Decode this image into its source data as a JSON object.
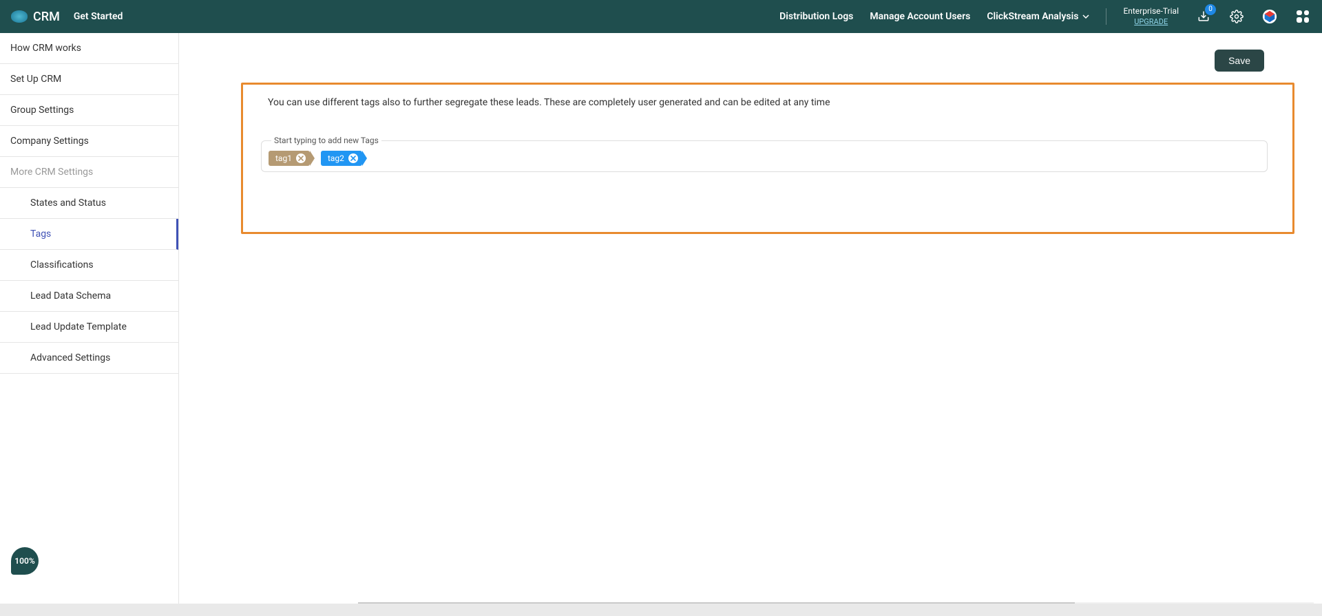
{
  "header": {
    "app_name": "CRM",
    "get_started": "Get Started",
    "nav": {
      "distribution_logs": "Distribution Logs",
      "manage_users": "Manage Account Users",
      "clickstream": "ClickStream Analysis"
    },
    "trial": {
      "line1": "Enterprise-Trial",
      "upgrade": "UPGRADE"
    },
    "notification_count": "0"
  },
  "sidebar": {
    "items": [
      {
        "label": "How CRM works"
      },
      {
        "label": "Set Up CRM"
      },
      {
        "label": "Group Settings"
      },
      {
        "label": "Company Settings"
      },
      {
        "label": "More CRM Settings",
        "muted": true
      }
    ],
    "subitems": [
      {
        "label": "States and Status"
      },
      {
        "label": "Tags",
        "active": true
      },
      {
        "label": "Classifications"
      },
      {
        "label": "Lead Data Schema"
      },
      {
        "label": "Lead Update Template"
      },
      {
        "label": "Advanced Settings"
      }
    ]
  },
  "progress_percent": "100%",
  "main": {
    "save_label": "Save",
    "description": "You can use different tags also to further segregate these leads. These are completely user generated and can be edited at any time",
    "tag_field_label": "Start typing to add new Tags",
    "tags": [
      {
        "label": "tag1",
        "color": "brown"
      },
      {
        "label": "tag2",
        "color": "blue"
      }
    ]
  }
}
